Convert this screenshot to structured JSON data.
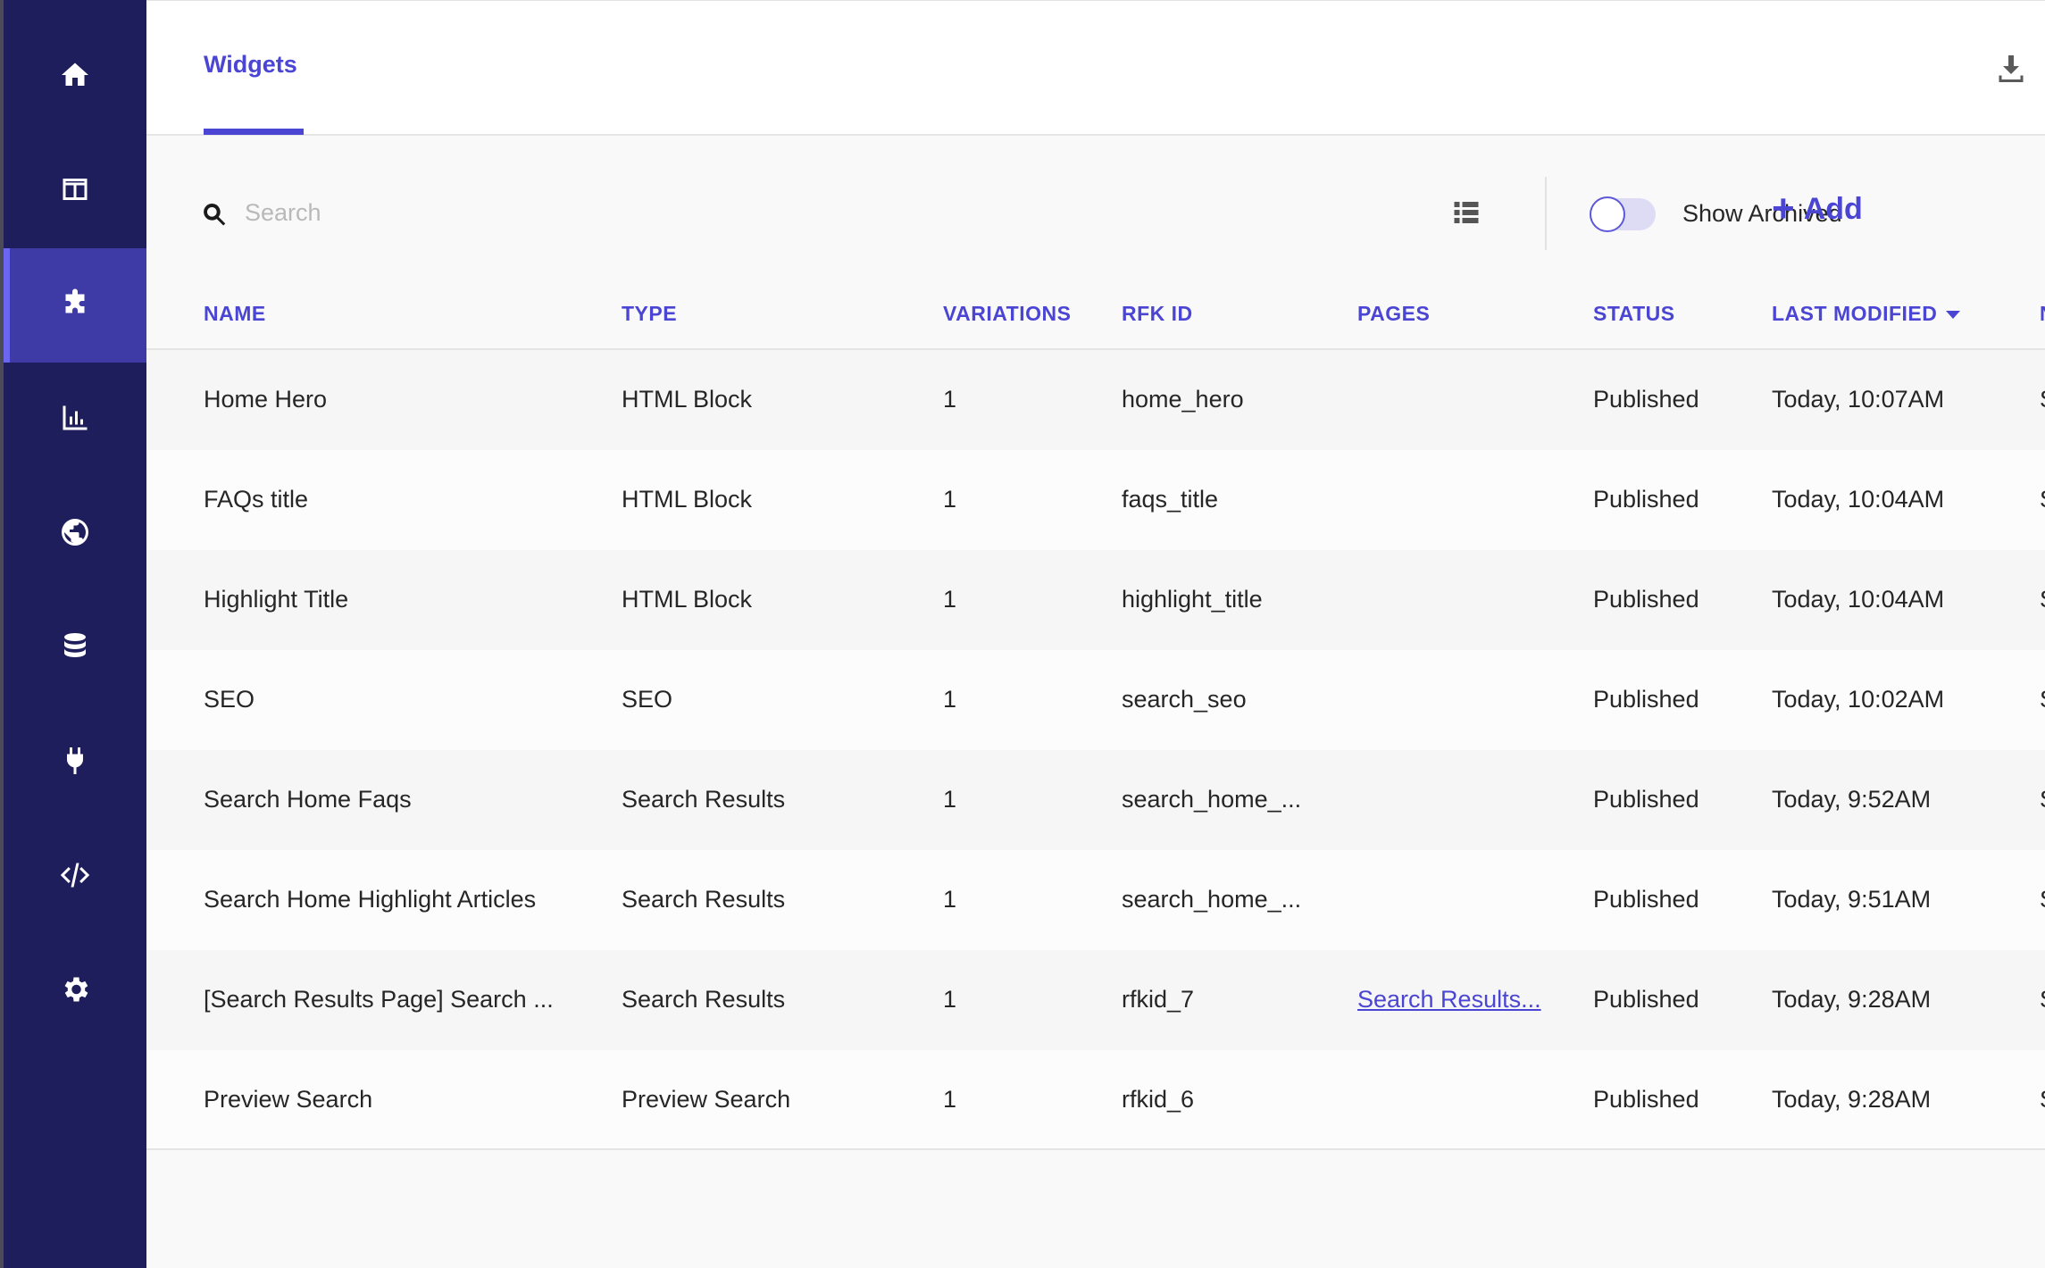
{
  "sidebar": {
    "items": [
      {
        "icon": "home-icon"
      },
      {
        "icon": "layout-icon"
      },
      {
        "icon": "puzzle-icon",
        "active": true
      },
      {
        "icon": "analytics-icon"
      },
      {
        "icon": "globe-icon"
      },
      {
        "icon": "database-icon"
      },
      {
        "icon": "plug-icon"
      },
      {
        "icon": "code-icon"
      },
      {
        "icon": "gear-icon"
      }
    ],
    "colors": {
      "background": "#1f1e5c",
      "active": "#3f3ba6"
    }
  },
  "header": {
    "tab_label": "Widgets",
    "download_icon": "download-icon"
  },
  "toolbar": {
    "search_placeholder": "Search",
    "search_value": "",
    "show_archived_label": "Show Archived",
    "show_archived_on": false,
    "add_label": "Add"
  },
  "table": {
    "columns": {
      "name": "NAME",
      "type": "TYPE",
      "variations": "VARIATIONS",
      "rfk_id": "RFK ID",
      "pages": "PAGES",
      "status": "STATUS",
      "last_modified": "LAST MODIFIED",
      "extra": "N"
    },
    "rows": [
      {
        "name": "Home Hero",
        "type": "HTML Block",
        "variations": "1",
        "rfk_id": "home_hero",
        "pages": "",
        "status": "Published",
        "last_modified": "Today, 10:07AM",
        "extra": "S"
      },
      {
        "name": "FAQs title",
        "type": "HTML Block",
        "variations": "1",
        "rfk_id": "faqs_title",
        "pages": "",
        "status": "Published",
        "last_modified": "Today, 10:04AM",
        "extra": "S"
      },
      {
        "name": "Highlight Title",
        "type": "HTML Block",
        "variations": "1",
        "rfk_id": "highlight_title",
        "pages": "",
        "status": "Published",
        "last_modified": "Today, 10:04AM",
        "extra": "S"
      },
      {
        "name": "SEO",
        "type": "SEO",
        "variations": "1",
        "rfk_id": "search_seo",
        "pages": "",
        "status": "Published",
        "last_modified": "Today, 10:02AM",
        "extra": "S"
      },
      {
        "name": "Search Home Faqs",
        "type": "Search Results",
        "variations": "1",
        "rfk_id": "search_home_...",
        "pages": "",
        "status": "Published",
        "last_modified": "Today, 9:52AM",
        "extra": "S"
      },
      {
        "name": "Search Home Highlight Articles",
        "type": "Search Results",
        "variations": "1",
        "rfk_id": "search_home_...",
        "pages": "",
        "status": "Published",
        "last_modified": "Today, 9:51AM",
        "extra": "S"
      },
      {
        "name": "[Search Results Page] Search ...",
        "type": "Search Results",
        "variations": "1",
        "rfk_id": "rfkid_7",
        "pages": "Search Results...",
        "status": "Published",
        "last_modified": "Today, 9:28AM",
        "extra": "S"
      },
      {
        "name": "Preview Search",
        "type": "Preview Search",
        "variations": "1",
        "rfk_id": "rfkid_6",
        "pages": "",
        "status": "Published",
        "last_modified": "Today, 9:28AM",
        "extra": "S"
      }
    ]
  },
  "accent_color": "#4b45d3"
}
